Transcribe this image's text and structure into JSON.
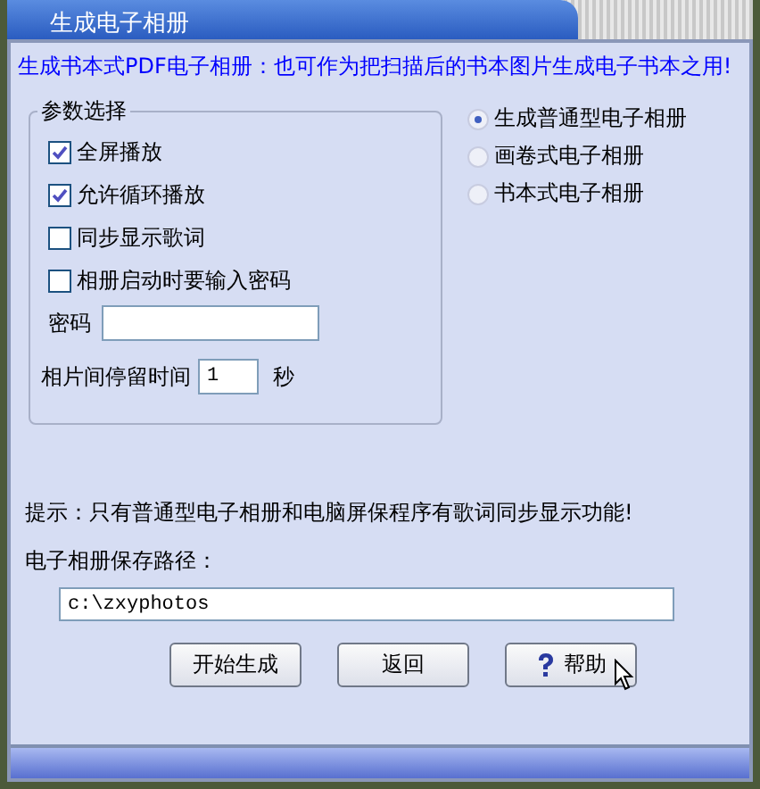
{
  "window": {
    "title": "生成电子相册"
  },
  "headline": "生成书本式PDF电子相册：也可作为把扫描后的书本图片生成电子书本之用!",
  "options_group": {
    "title": "参数选择",
    "checkboxes": [
      {
        "label": "全屏播放",
        "checked": true
      },
      {
        "label": "允许循环播放",
        "checked": true
      },
      {
        "label": "同步显示歌词",
        "checked": false
      },
      {
        "label": "相册启动时要输入密码",
        "checked": false
      }
    ],
    "password": {
      "label": "密码"
    },
    "interval": {
      "label": "相片间停留时间",
      "value": "1",
      "unit": "秒"
    }
  },
  "album_types": [
    {
      "label": "生成普通型电子相册",
      "selected": true
    },
    {
      "label": "画卷式电子相册",
      "selected": false
    },
    {
      "label": "书本式电子相册",
      "selected": false
    }
  ],
  "hint": "提示：只有普通型电子相册和电脑屏保程序有歌词同步显示功能!",
  "save_path": {
    "label": "电子相册保存路径：",
    "value": "c:\\zxyphotos"
  },
  "buttons": [
    {
      "label": "开始生成",
      "kind": "plain"
    },
    {
      "label": "返回",
      "kind": "plain"
    },
    {
      "label": "帮助",
      "kind": "help"
    }
  ]
}
